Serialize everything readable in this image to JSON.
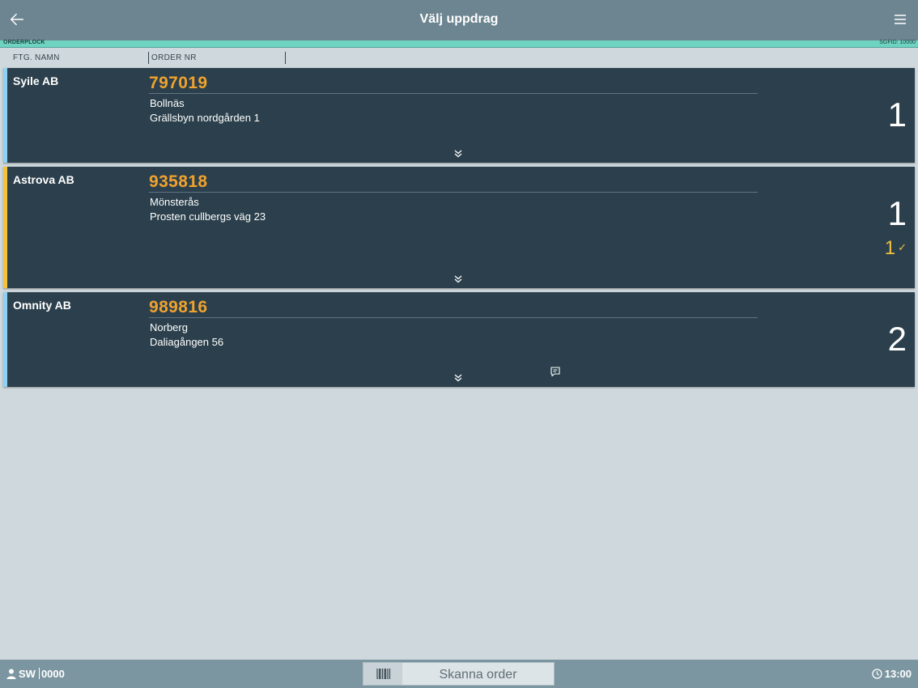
{
  "header": {
    "title": "Välj uppdrag",
    "back_icon": "arrow-left-icon",
    "menu_icon": "hamburger-menu-icon"
  },
  "status": {
    "mode": "ORDERPLOCK",
    "id_label": "SGFID: 10000",
    "color": "#6fd3c2"
  },
  "columns": {
    "company": "FTG. NAMN",
    "order_no": "ORDER NR"
  },
  "orders": [
    {
      "company": "Syile AB",
      "order_no": "797019",
      "city": "Bollnäs",
      "street": "Grällsbyn nordgården 1",
      "qty": "1",
      "stripe_color": "#8fd0f5"
    },
    {
      "company": "Astrova AB",
      "order_no": "935818",
      "city": "Mönsterås",
      "street": "Prosten cullbergs väg 23",
      "qty": "1",
      "done": "1",
      "stripe_color": "#f5c33b"
    },
    {
      "company": "Omnity AB",
      "order_no": "989816",
      "city": "Norberg",
      "street": "Daliagången 56",
      "qty": "2",
      "has_comment": true,
      "stripe_color": "#8fd0f5"
    }
  ],
  "footer": {
    "user": "SW",
    "user_id": "0000",
    "scan_label": "Skanna order",
    "time": "13:00"
  },
  "colors": {
    "header_bg": "#6d8591",
    "card_bg": "#2b404c",
    "order_no": "#f0a22e",
    "page_bg": "#cfd8dc"
  }
}
